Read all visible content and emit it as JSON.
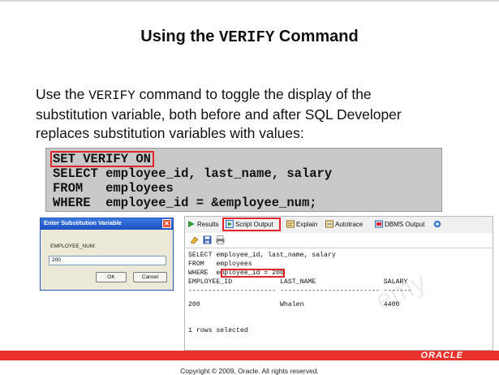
{
  "slide": {
    "title_prefix": "Using the ",
    "title_code": "VERIFY",
    "title_suffix": " Command",
    "body_line1_prefix": "Use the ",
    "body_line1_code": "VERIFY",
    "body_line1_suffix": " command to toggle the display of the",
    "body_line2": "substitution variable, both before and after SQL Developer",
    "body_line3": "replaces substitution variables with values:",
    "code": [
      "SET VERIFY ON",
      "SELECT employee_id, last_name, salary",
      "FROM   employees",
      "WHERE  employee_id = &employee_num;"
    ],
    "copyright": "Copyright © 2009, Oracle. All rights reserved.",
    "watermark": "emy",
    "logo": "ORACLE"
  },
  "dialog": {
    "title": "Enter Substitution Variable",
    "label": "EMPLOYEE_NUM:",
    "value": "200",
    "ok": "OK",
    "cancel": "Cancel"
  },
  "panel": {
    "tabs": [
      "Results",
      "Script Output",
      "Explain",
      "Autotrace",
      "DBMS Output"
    ],
    "selected_tab": "Script Output",
    "output": [
      "SELECT employee_id, last_name, salary",
      "FROM   employees",
      "WHERE  employee_id = 200",
      "EMPLOYEE_ID            LAST_NAME                 SALARY",
      "---------------------- ------------------------- -------",
      "200                    Whalen                    4400",
      "",
      "1 rows selected"
    ]
  },
  "colors": {
    "highlight": "#e0262a",
    "footer": "#e8322b",
    "code_bg": "#c9c9c9",
    "dialog_bar": "#2c56b5"
  },
  "icons": [
    "close-icon",
    "run-icon",
    "script-icon",
    "explain-icon",
    "autotrace-icon",
    "dbms-icon",
    "connection-icon",
    "eraser-icon",
    "save-icon",
    "print-icon"
  ]
}
